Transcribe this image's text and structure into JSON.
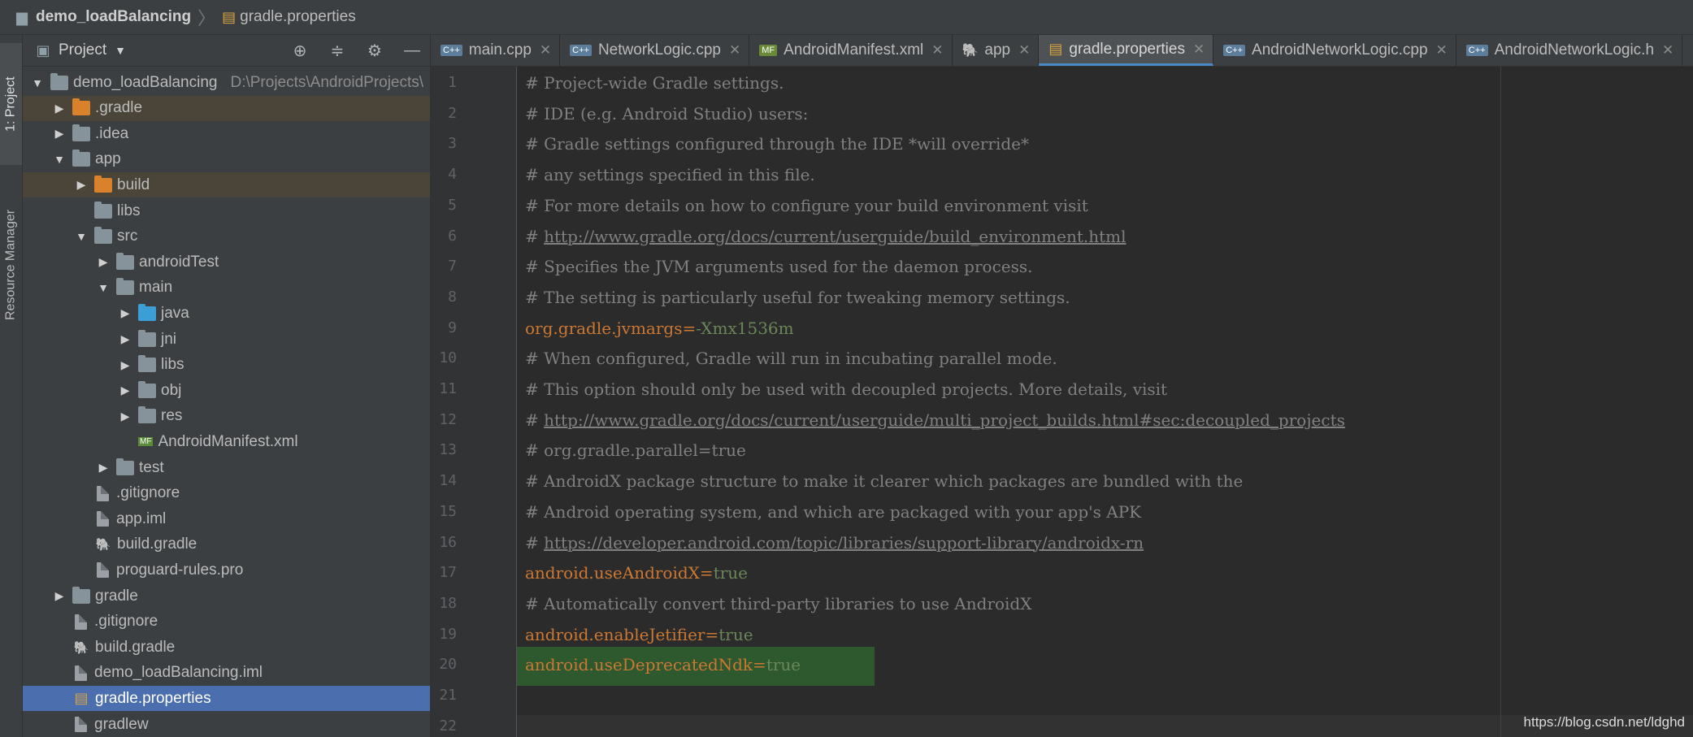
{
  "breadcrumb": {
    "project": "demo_loadBalancing",
    "file": "gradle.properties"
  },
  "tool_stripe": {
    "project_tab": "1: Project",
    "resource_tab": "Resource Manager"
  },
  "project_panel": {
    "title": "Project",
    "rows": [
      {
        "label": "demo_loadBalancing",
        "hint": "D:\\Projects\\AndroidProjects\\",
        "indent": 0,
        "arrow": "down",
        "icon": "module-folder"
      },
      {
        "label": ".gradle",
        "indent": 1,
        "arrow": "right",
        "icon": "folder-orange",
        "excluded": true
      },
      {
        "label": ".idea",
        "indent": 1,
        "arrow": "right",
        "icon": "folder"
      },
      {
        "label": "app",
        "indent": 1,
        "arrow": "down",
        "icon": "folder"
      },
      {
        "label": "build",
        "indent": 2,
        "arrow": "right",
        "icon": "folder-orange",
        "excluded": true
      },
      {
        "label": "libs",
        "indent": 2,
        "arrow": "none",
        "icon": "folder"
      },
      {
        "label": "src",
        "indent": 2,
        "arrow": "down",
        "icon": "folder"
      },
      {
        "label": "androidTest",
        "indent": 3,
        "arrow": "right",
        "icon": "folder"
      },
      {
        "label": "main",
        "indent": 3,
        "arrow": "down",
        "icon": "folder"
      },
      {
        "label": "java",
        "indent": 4,
        "arrow": "right",
        "icon": "folder-blue"
      },
      {
        "label": "jni",
        "indent": 4,
        "arrow": "right",
        "icon": "folder"
      },
      {
        "label": "libs",
        "indent": 4,
        "arrow": "right",
        "icon": "folder"
      },
      {
        "label": "obj",
        "indent": 4,
        "arrow": "right",
        "icon": "folder"
      },
      {
        "label": "res",
        "indent": 4,
        "arrow": "right",
        "icon": "folder"
      },
      {
        "label": "AndroidManifest.xml",
        "indent": 4,
        "arrow": "none",
        "icon": "manifest"
      },
      {
        "label": "test",
        "indent": 3,
        "arrow": "right",
        "icon": "folder"
      },
      {
        "label": ".gitignore",
        "indent": 2,
        "arrow": "none",
        "icon": "file"
      },
      {
        "label": "app.iml",
        "indent": 2,
        "arrow": "none",
        "icon": "file"
      },
      {
        "label": "build.gradle",
        "indent": 2,
        "arrow": "none",
        "icon": "gradle"
      },
      {
        "label": "proguard-rules.pro",
        "indent": 2,
        "arrow": "none",
        "icon": "file"
      },
      {
        "label": "gradle",
        "indent": 1,
        "arrow": "right",
        "icon": "folder"
      },
      {
        "label": ".gitignore",
        "indent": 1,
        "arrow": "none",
        "icon": "file"
      },
      {
        "label": "build.gradle",
        "indent": 1,
        "arrow": "none",
        "icon": "gradle"
      },
      {
        "label": "demo_loadBalancing.iml",
        "indent": 1,
        "arrow": "none",
        "icon": "file"
      },
      {
        "label": "gradle.properties",
        "indent": 1,
        "arrow": "none",
        "icon": "properties",
        "selected": true
      },
      {
        "label": "gradlew",
        "indent": 1,
        "arrow": "none",
        "icon": "file"
      }
    ]
  },
  "tabs": [
    {
      "label": "main.cpp",
      "icon": "C++"
    },
    {
      "label": "NetworkLogic.cpp",
      "icon": "C++"
    },
    {
      "label": "AndroidManifest.xml",
      "icon": "MF"
    },
    {
      "label": "app",
      "icon": "gradle"
    },
    {
      "label": "gradle.properties",
      "icon": "properties",
      "active": true
    },
    {
      "label": "AndroidNetworkLogic.cpp",
      "icon": "C++"
    },
    {
      "label": "AndroidNetworkLogic.h",
      "icon": "C++"
    }
  ],
  "editor": {
    "lines": [
      {
        "n": "1",
        "kind": "comment",
        "text": "# Project-wide Gradle settings."
      },
      {
        "n": "2",
        "kind": "comment",
        "text": "# IDE (e.g. Android Studio) users:"
      },
      {
        "n": "3",
        "kind": "comment",
        "text": "# Gradle settings configured through the IDE *will override*"
      },
      {
        "n": "4",
        "kind": "comment",
        "text": "# any settings specified in this file."
      },
      {
        "n": "5",
        "kind": "comment",
        "text": "# For more details on how to configure your build environment visit"
      },
      {
        "n": "6",
        "kind": "link",
        "prefix": "# ",
        "text": "http://www.gradle.org/docs/current/userguide/build_environment.html"
      },
      {
        "n": "7",
        "kind": "comment",
        "text": "# Specifies the JVM arguments used for the daemon process."
      },
      {
        "n": "8",
        "kind": "comment",
        "text": "# The setting is particularly useful for tweaking memory settings."
      },
      {
        "n": "9",
        "kind": "prop",
        "key": "org.gradle.jvmargs",
        "value": "-Xmx1536m"
      },
      {
        "n": "10",
        "kind": "comment",
        "text": "# When configured, Gradle will run in incubating parallel mode."
      },
      {
        "n": "11",
        "kind": "comment",
        "text": "# This option should only be used with decoupled projects. More details, visit"
      },
      {
        "n": "12",
        "kind": "link",
        "prefix": "# ",
        "text": "http://www.gradle.org/docs/current/userguide/multi_project_builds.html#sec:decoupled_projects"
      },
      {
        "n": "13",
        "kind": "comment",
        "text": "# org.gradle.parallel=true"
      },
      {
        "n": "14",
        "kind": "comment",
        "text": "# AndroidX package structure to make it clearer which packages are bundled with the"
      },
      {
        "n": "15",
        "kind": "comment",
        "text": "# Android operating system, and which are packaged with your app's APK"
      },
      {
        "n": "16",
        "kind": "link",
        "prefix": "# ",
        "text": "https://developer.android.com/topic/libraries/support-library/androidx-rn"
      },
      {
        "n": "17",
        "kind": "prop",
        "key": "android.useAndroidX",
        "value": "true"
      },
      {
        "n": "18",
        "kind": "comment",
        "text": "# Automatically convert third-party libraries to use AndroidX"
      },
      {
        "n": "19",
        "kind": "prop",
        "key": "android.enableJetifier",
        "value": "true"
      },
      {
        "n": "20",
        "kind": "prop",
        "key": "android.useDeprecatedNdk",
        "value": "true"
      },
      {
        "n": "21",
        "kind": "empty",
        "text": ""
      },
      {
        "n": "22",
        "kind": "empty",
        "text": ""
      }
    ]
  },
  "watermark": "https://blog.csdn.net/ldghd",
  "colors": {
    "comment": "#808080",
    "key": "#cc7832",
    "value": "#6a8759",
    "selection": "#4b6eaf",
    "highlight": "#2e5b2e"
  }
}
